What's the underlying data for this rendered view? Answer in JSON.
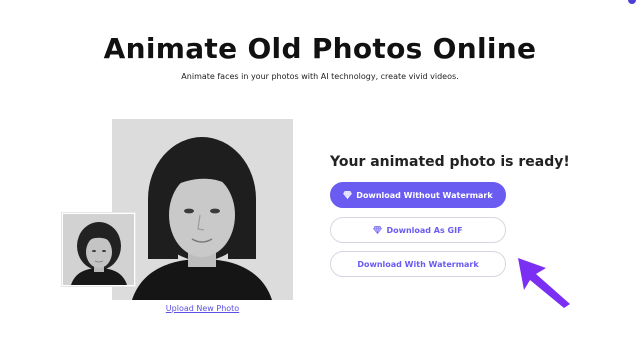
{
  "page": {
    "title": "Animate Old Photos Online",
    "subtitle": "Animate faces in your photos with AI technology, create vivid videos."
  },
  "result": {
    "heading": "Your animated photo is ready!",
    "download_no_watermark": "Download Without Watermark",
    "download_gif": "Download As GIF",
    "download_watermark": "Download With Watermark"
  },
  "upload": {
    "link_label": "Upload New Photo"
  },
  "colors": {
    "accent": "#6a5cf0",
    "arrow": "#7b2ff2"
  },
  "icons": {
    "premium": "diamond-icon",
    "pointer": "pointer-arrow-icon"
  }
}
